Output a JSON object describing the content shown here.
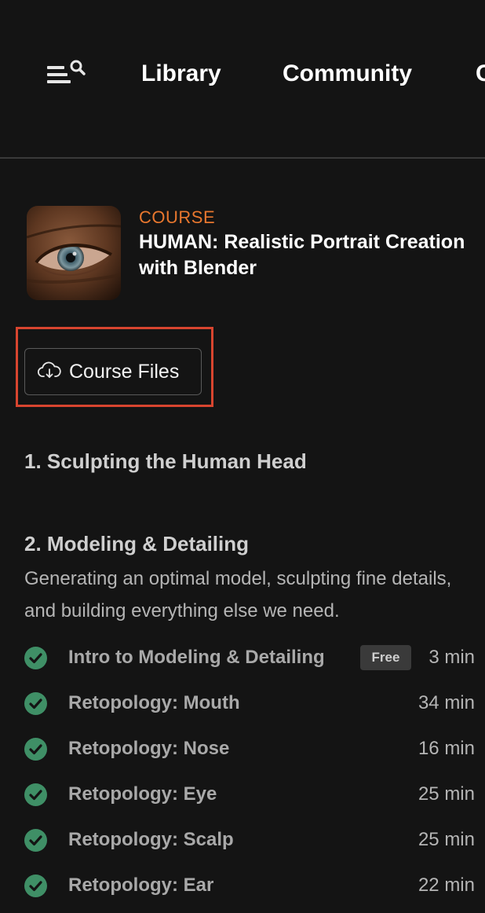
{
  "nav": {
    "menu_icon": "menu-search-icon",
    "links": [
      "Library",
      "Community",
      "C"
    ]
  },
  "course": {
    "kicker": "COURSE",
    "title": "HUMAN: Realistic Portrait Creation with Blender",
    "thumbnail": "portrait-eye-closeup"
  },
  "course_files": {
    "label": "Course Files",
    "icon": "cloud-download-icon",
    "highlight_color": "#d8452f"
  },
  "sections": [
    {
      "title": "1. Sculpting the Human Head"
    },
    {
      "title": "2. Modeling & Detailing",
      "description": "Generating an optimal model, sculpting fine details, and building everything else we need.",
      "lessons": [
        {
          "title": "Intro to Modeling & Detailing",
          "badge": "Free",
          "duration": "3 min",
          "completed": true
        },
        {
          "title": "Retopology: Mouth",
          "badge": "",
          "duration": "34 min",
          "completed": true
        },
        {
          "title": "Retopology: Nose",
          "badge": "",
          "duration": "16 min",
          "completed": true
        },
        {
          "title": "Retopology: Eye",
          "badge": "",
          "duration": "25 min",
          "completed": true
        },
        {
          "title": "Retopology: Scalp",
          "badge": "",
          "duration": "25 min",
          "completed": true
        },
        {
          "title": "Retopology: Ear",
          "badge": "",
          "duration": "22 min",
          "completed": true
        }
      ]
    }
  ],
  "colors": {
    "background": "#141414",
    "accent_orange": "#e8772e",
    "check_green": "#3f8f66",
    "badge_bg": "#3a3a3a"
  }
}
